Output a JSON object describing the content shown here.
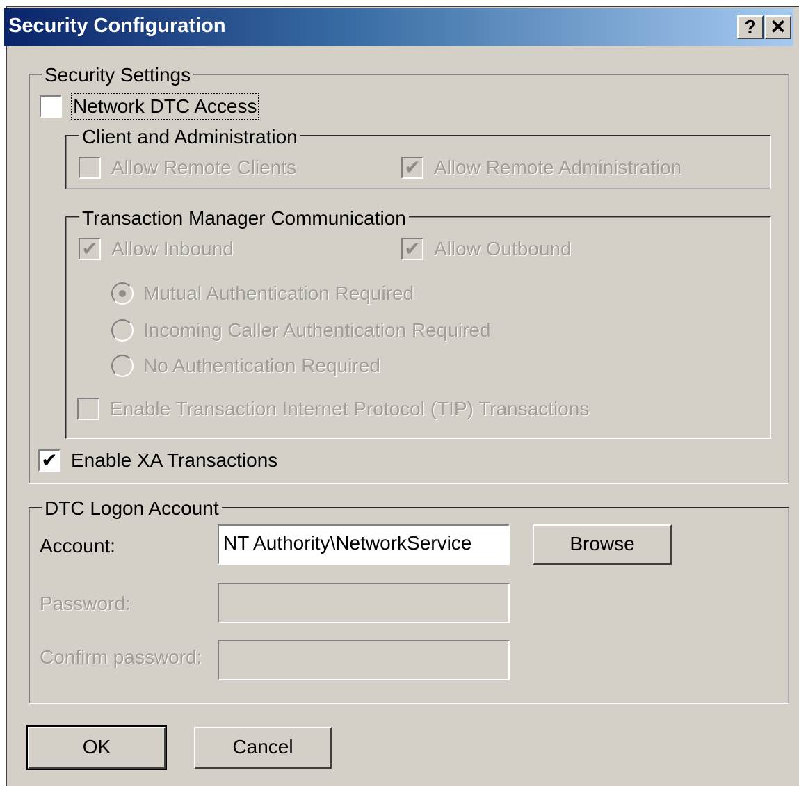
{
  "window": {
    "title": "Security Configuration",
    "help_button": "?",
    "close_button": "✕"
  },
  "security_settings": {
    "legend": "Security Settings",
    "network_dtc_access": {
      "label": "Network DTC Access",
      "checked": false
    },
    "client_admin": {
      "legend": "Client and Administration",
      "allow_remote_clients": {
        "label": "Allow Remote Clients",
        "checked": false
      },
      "allow_remote_administration": {
        "label": "Allow Remote Administration",
        "checked": true
      }
    },
    "tm_communication": {
      "legend": "Transaction Manager Communication",
      "allow_inbound": {
        "label": "Allow Inbound",
        "checked": true
      },
      "allow_outbound": {
        "label": "Allow Outbound",
        "checked": true
      },
      "auth_options": [
        {
          "label": "Mutual Authentication Required",
          "selected": true
        },
        {
          "label": "Incoming Caller Authentication Required",
          "selected": false
        },
        {
          "label": "No Authentication Required",
          "selected": false
        }
      ],
      "enable_tip": {
        "label": "Enable Transaction Internet Protocol (TIP) Transactions",
        "checked": false
      }
    },
    "enable_xa": {
      "label": "Enable XA Transactions",
      "checked": true
    }
  },
  "logon_account": {
    "legend": "DTC Logon Account",
    "account_label": "Account:",
    "account_value": "NT Authority\\NetworkService",
    "browse_button": "Browse",
    "password_label": "Password:",
    "password_value": "",
    "confirm_label": "Confirm password:",
    "confirm_value": ""
  },
  "buttons": {
    "ok": "OK",
    "cancel": "Cancel"
  }
}
